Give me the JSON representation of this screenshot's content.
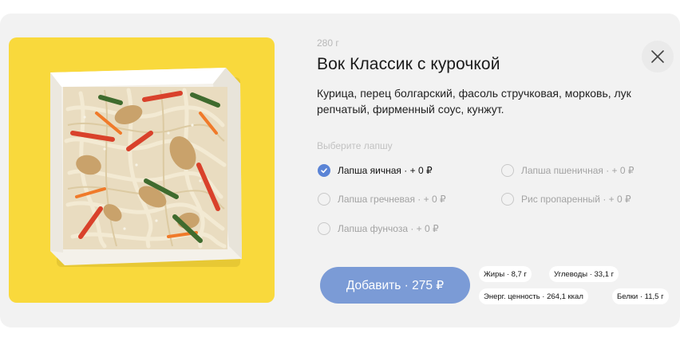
{
  "product": {
    "weight": "280 г",
    "title": "Вок Классик с курочкой",
    "description": "Курица, перец болгарский, фасоль стручковая, морковь, лук репчатый, фирменный соус, кунжут."
  },
  "noodle_choice": {
    "label": "Выберите лапшу",
    "options": [
      {
        "label": "Лапша яичная · + 0 ₽",
        "selected": true
      },
      {
        "label": "Лапша пшеничная · + 0 ₽",
        "selected": false
      },
      {
        "label": "Лапша гречневая · + 0 ₽",
        "selected": false
      },
      {
        "label": "Рис пропаренный · + 0 ₽",
        "selected": false
      },
      {
        "label": "Лапша фунчоза · + 0 ₽",
        "selected": false
      }
    ]
  },
  "add_button": {
    "label": "Добавить · 275 ₽"
  },
  "nutrition": {
    "fats": "Жиры · 8,7 г",
    "carbs": "Углеводы · 33,1 г",
    "energy": "Энерг. ценность · 264,1 ккал",
    "proteins": "Белки · 11,5 г"
  },
  "colors": {
    "accent": "#5b84d6",
    "button": "#7b9bd6",
    "image_background": "#f9d93c"
  },
  "icons": {
    "close": "close-icon",
    "checked": "check-icon"
  }
}
